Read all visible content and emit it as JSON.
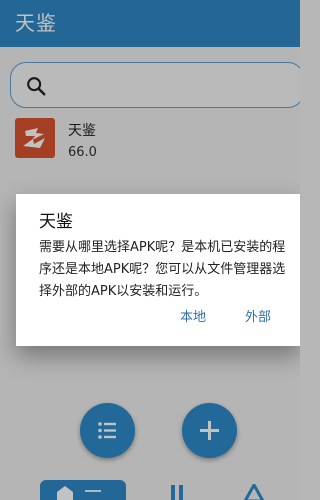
{
  "app_bar": {
    "title": "天鉴"
  },
  "search": {
    "icon": "search-icon",
    "placeholder": ""
  },
  "app_list": [
    {
      "name": "天鉴",
      "version": "66.0",
      "icon": "app-logo-icon"
    }
  ],
  "dialog": {
    "title": "天鉴",
    "message": "需要从哪里选择APK呢？是本机已安装的程序还是本地APK呢？您可以从文件管理器选择外部的APK以安装和运行。",
    "buttons": {
      "local": "本地",
      "external": "外部"
    }
  },
  "fabs": [
    {
      "icon": "list-icon"
    },
    {
      "icon": "add-icon"
    }
  ],
  "bottom_nav": {
    "icons": [
      "home-icon",
      "bars-icon",
      "delta-icon"
    ]
  },
  "colors": {
    "primary": "#2f88c7",
    "accent": "#2d8bcb",
    "dialog_button": "#2d6fb7",
    "app_icon": "#d9532f"
  }
}
